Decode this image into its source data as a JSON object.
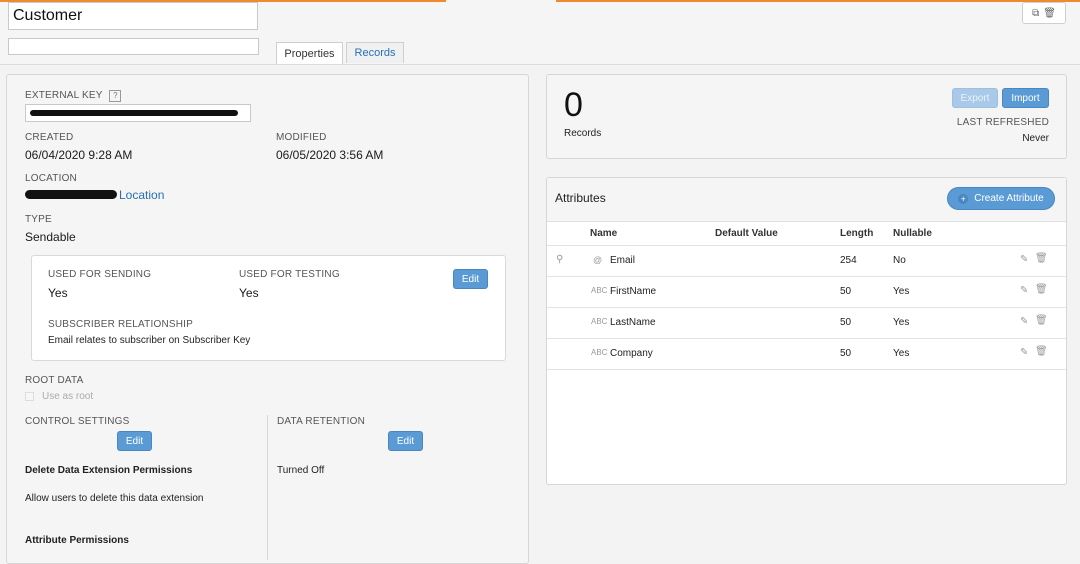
{
  "header": {
    "name_value": "Customer",
    "description_value": "",
    "tabs": [
      {
        "label": "Properties"
      },
      {
        "label": "Records"
      }
    ]
  },
  "properties": {
    "external_key": {
      "label": "EXTERNAL KEY",
      "help": "?",
      "value": ""
    },
    "created": {
      "label": "CREATED",
      "value": "06/04/2020 9:28 AM"
    },
    "modified": {
      "label": "MODIFIED",
      "value": "06/05/2020 3:56 AM"
    },
    "location": {
      "label": "LOCATION",
      "link": "Location"
    },
    "type": {
      "label": "TYPE",
      "value": "Sendable"
    },
    "sending": {
      "used_for_sending_label": "USED FOR SENDING",
      "used_for_sending_value": "Yes",
      "used_for_testing_label": "USED FOR TESTING",
      "used_for_testing_value": "Yes",
      "edit_label": "Edit",
      "subscriber_relationship_label": "SUBSCRIBER RELATIONSHIP",
      "subscriber_relationship_value": "Email relates to subscriber on Subscriber Key"
    },
    "root_data": {
      "label": "ROOT DATA",
      "checkbox_label": "Use as root"
    },
    "control_settings": {
      "label": "CONTROL SETTINGS",
      "edit_label": "Edit",
      "delete_perm_title": "Delete Data Extension Permissions",
      "delete_perm_text": "Allow users to delete this data extension",
      "attr_perm_title": "Attribute Permissions"
    },
    "data_retention": {
      "label": "DATA RETENTION",
      "edit_label": "Edit",
      "value": "Turned Off"
    }
  },
  "records_panel": {
    "count": "0",
    "count_label": "Records",
    "export_label": "Export",
    "import_label": "Import",
    "last_refreshed_label": "LAST REFRESHED",
    "last_refreshed_value": "Never"
  },
  "attributes": {
    "title": "Attributes",
    "create_label": "Create Attribute",
    "columns": {
      "name": "Name",
      "default_value": "Default Value",
      "length": "Length",
      "nullable": "Nullable"
    },
    "rows": [
      {
        "type_icon": "@",
        "name": "Email",
        "default_value": "",
        "length": "254",
        "nullable": "No",
        "primary_key": true
      },
      {
        "type_icon": "ABC",
        "name": "FirstName",
        "default_value": "",
        "length": "50",
        "nullable": "Yes",
        "primary_key": false
      },
      {
        "type_icon": "ABC",
        "name": "LastName",
        "default_value": "",
        "length": "50",
        "nullable": "Yes",
        "primary_key": false
      },
      {
        "type_icon": "ABC",
        "name": "Company",
        "default_value": "",
        "length": "50",
        "nullable": "Yes",
        "primary_key": false
      }
    ]
  },
  "colors": {
    "accent_orange": "#f08b2d",
    "button_blue": "#5b9bd5",
    "link_blue": "#2a6fb3"
  }
}
